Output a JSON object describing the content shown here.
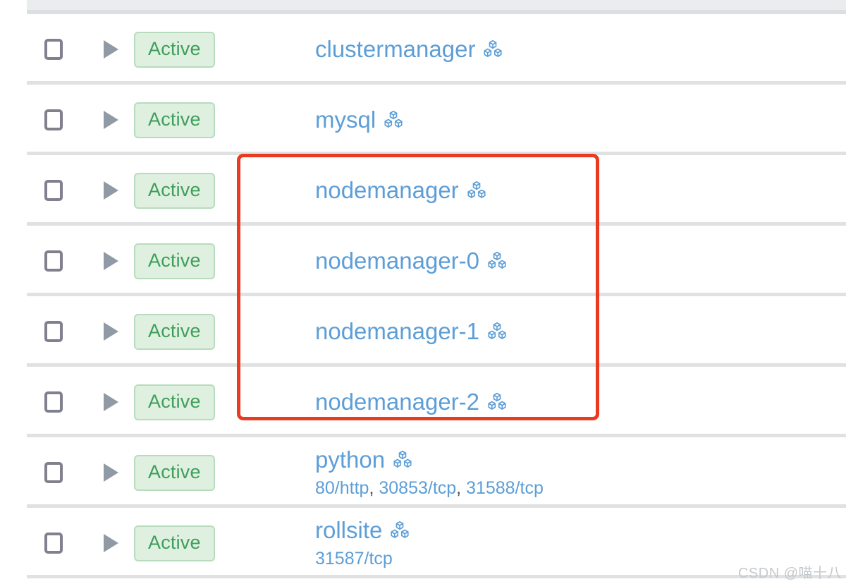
{
  "header": {
    "strip_label": ""
  },
  "table": {
    "columns": [
      "select",
      "expand",
      "status",
      "name"
    ],
    "rows": [
      {
        "checkbox_checked": false,
        "expand_icon": "triangle-right-icon",
        "status": "Active",
        "name": "clustermanager",
        "name_icon": "cube-stack-icon",
        "ports": "",
        "highlighted": false
      },
      {
        "checkbox_checked": false,
        "expand_icon": "triangle-right-icon",
        "status": "Active",
        "name": "mysql",
        "name_icon": "cube-stack-icon",
        "ports": "",
        "highlighted": false
      },
      {
        "checkbox_checked": false,
        "expand_icon": "triangle-right-icon",
        "status": "Active",
        "name": "nodemanager",
        "name_icon": "cube-stack-icon",
        "ports": "",
        "highlighted": true
      },
      {
        "checkbox_checked": false,
        "expand_icon": "triangle-right-icon",
        "status": "Active",
        "name": "nodemanager-0",
        "name_icon": "cube-stack-icon",
        "ports": "",
        "highlighted": true
      },
      {
        "checkbox_checked": false,
        "expand_icon": "triangle-right-icon",
        "status": "Active",
        "name": "nodemanager-1",
        "name_icon": "cube-stack-icon",
        "ports": "",
        "highlighted": true
      },
      {
        "checkbox_checked": false,
        "expand_icon": "triangle-right-icon",
        "status": "Active",
        "name": "nodemanager-2",
        "name_icon": "cube-stack-icon",
        "ports": "",
        "highlighted": true
      },
      {
        "checkbox_checked": false,
        "expand_icon": "triangle-right-icon",
        "status": "Active",
        "name": "python",
        "name_icon": "cube-stack-icon",
        "ports": "80/http, 30853/tcp, 31588/tcp",
        "highlighted": false
      },
      {
        "checkbox_checked": false,
        "expand_icon": "triangle-right-icon",
        "status": "Active",
        "name": "rollsite",
        "name_icon": "cube-stack-icon",
        "ports": "31587/tcp",
        "highlighted": false
      }
    ]
  },
  "annotation": {
    "shape": "rectangle",
    "color": "#ec3a21",
    "covers": [
      "nodemanager",
      "nodemanager-0",
      "nodemanager-1",
      "nodemanager-2"
    ]
  },
  "watermark": {
    "text": "CSDN @喵十八",
    "color": "#c6c9cc"
  },
  "colors": {
    "link": "#5d9ed7",
    "badge_text": "#3f9e5a",
    "badge_bg": "#dff0e1",
    "badge_border": "#b7dcbd",
    "row_separator": "#dfe1e3",
    "header_strip": "#e9edee",
    "annotation": "#ec3a21",
    "checkbox_border": "#80808f",
    "arrow": "#909aa5"
  }
}
